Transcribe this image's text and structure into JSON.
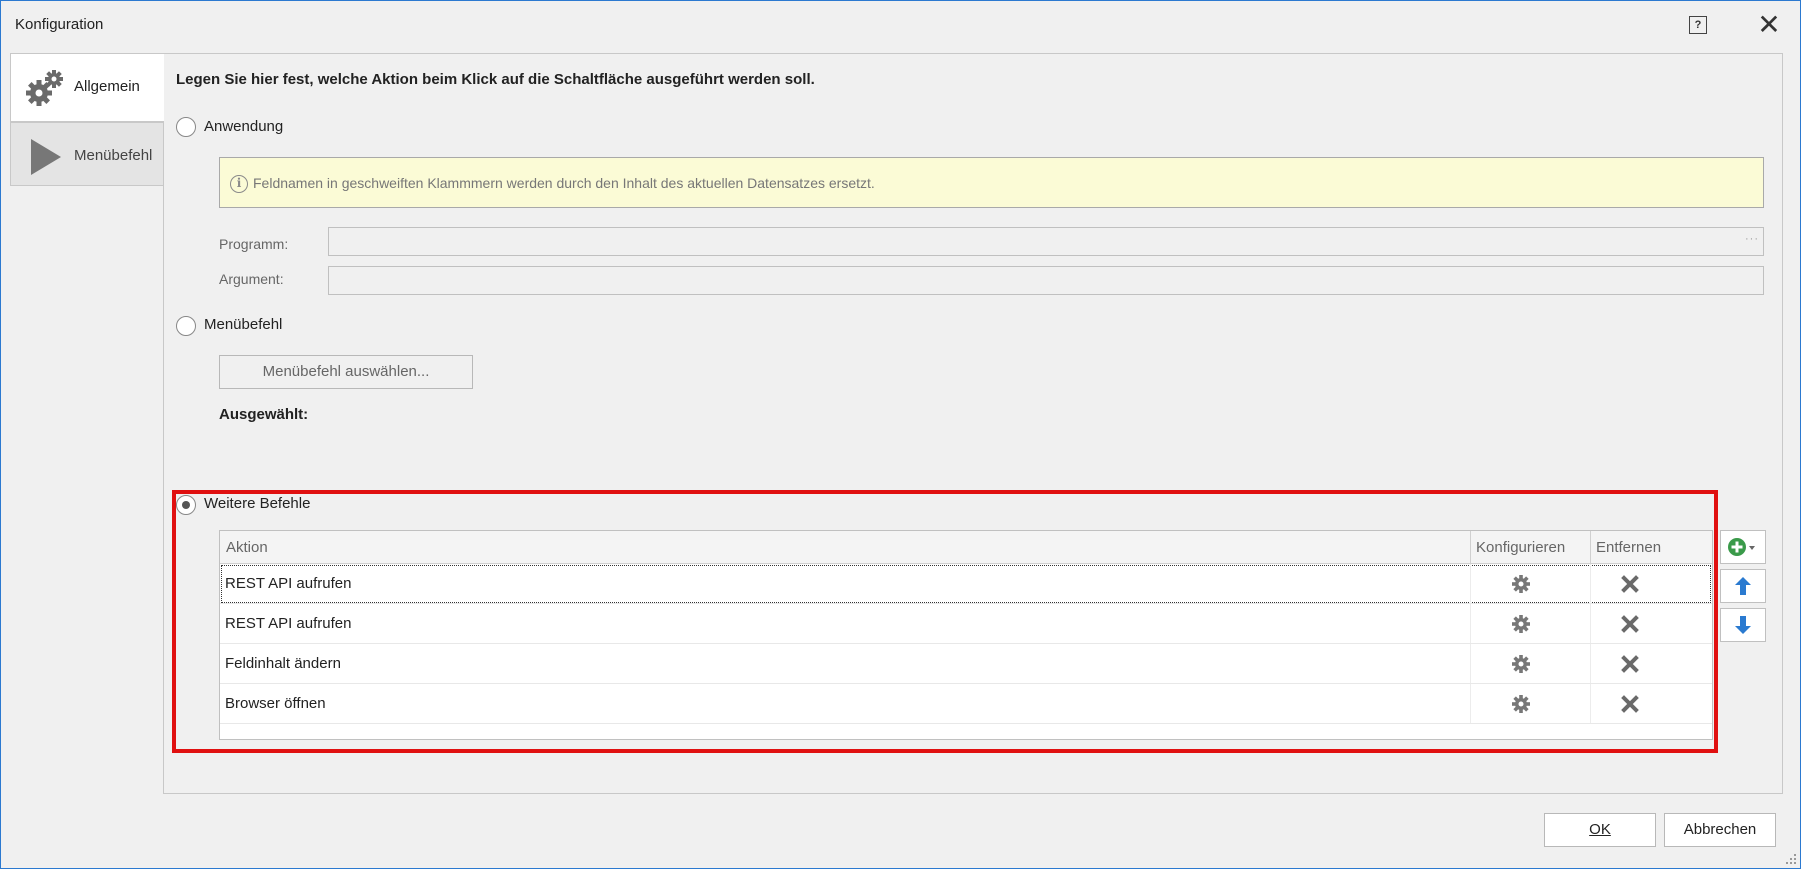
{
  "window": {
    "title": "Konfiguration",
    "help_icon": "help-icon",
    "close_icon": "close-icon"
  },
  "tabs": [
    {
      "label": "Allgemein",
      "icon": "gears-icon",
      "active": true
    },
    {
      "label": "Menübefehl",
      "icon": "play-icon",
      "active": false
    }
  ],
  "main": {
    "heading": "Legen Sie hier fest, welche Aktion beim Klick auf die Schaltfläche ausgeführt werden soll.",
    "option_application": {
      "label": "Anwendung",
      "checked": false,
      "info_text": "Feldnamen in geschweiften Klammmern werden durch den Inhalt des aktuellen Datensatzes ersetzt.",
      "program_label": "Programm:",
      "program_value": "",
      "argument_label": "Argument:",
      "argument_value": "",
      "browse_label": "···"
    },
    "option_menu": {
      "label": "Menübefehl",
      "checked": false,
      "select_button": "Menübefehl auswählen...",
      "selected_label": "Ausgewählt:"
    },
    "option_more": {
      "label": "Weitere Befehle",
      "checked": true,
      "columns": [
        "Aktion",
        "Konfigurieren",
        "Entfernen"
      ],
      "rows": [
        {
          "action": "REST API aufrufen"
        },
        {
          "action": "REST API aufrufen"
        },
        {
          "action": "Feldinhalt ändern"
        },
        {
          "action": "Browser öffnen"
        }
      ]
    }
  },
  "footer": {
    "ok_label": "OK",
    "cancel_label": "Abbrechen"
  },
  "colors": {
    "highlight": "#e01010",
    "info_bg": "#fbfbd6",
    "accent_green": "#3a9a4a",
    "accent_blue": "#2a7ad0"
  }
}
